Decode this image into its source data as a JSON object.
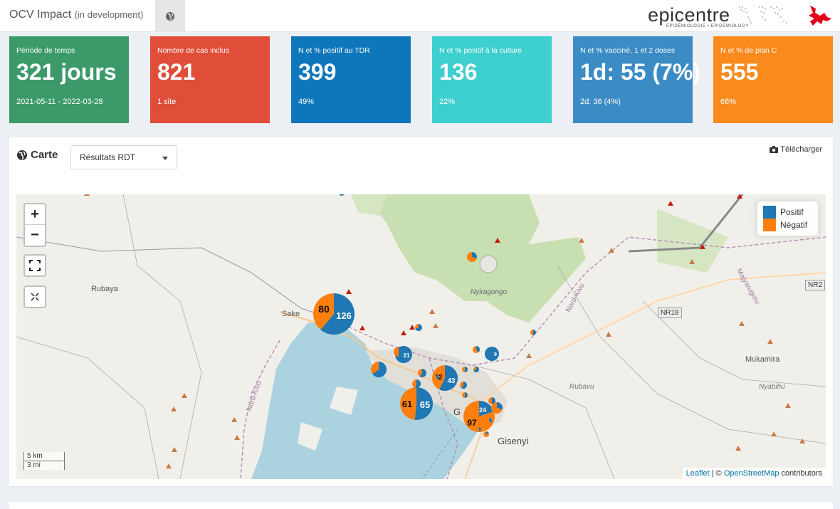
{
  "header": {
    "title": "OCV Impact",
    "subtitle": "(in development)",
    "logo_text": "epicentre",
    "logo_tagline": "ÉPIDÉMIOLOGIE • EPIDEMIOLOGY"
  },
  "value_boxes": [
    {
      "label": "Période de temps",
      "value": "321 jours",
      "sub": "2021-05-11 - 2022-03-28",
      "color": "#3c9a6a"
    },
    {
      "label": "Nombre de cas inclus",
      "value": "821",
      "sub": "1 site",
      "color": "#e04e3a"
    },
    {
      "label": "N et % positif au TDR",
      "value": "399",
      "sub": "49%",
      "color": "#0e76ba"
    },
    {
      "label": "N et % positif à la culture",
      "value": "136",
      "sub": "22%",
      "color": "#3ecfcf"
    },
    {
      "label": "N et % vacciné, 1 et 2 doses",
      "value": "1d: 55 (7%)",
      "sub": "2d: 36 (4%)",
      "color": "#3b8bc4"
    },
    {
      "label": "N et % de plan C",
      "value": "555",
      "sub": "68%",
      "color": "#fb8a1c"
    }
  ],
  "map_panel": {
    "title": "Carte",
    "dropdown_value": "Résultats RDT",
    "download_label": "Télécharger"
  },
  "map": {
    "zoom_in": "+",
    "zoom_out": "−",
    "legend": [
      {
        "label": "Positif",
        "color": "#1f77b4"
      },
      {
        "label": "Négatif",
        "color": "#ff7f0e"
      }
    ],
    "scale_km": "5 km",
    "scale_mi": "3 mi",
    "attribution_leaflet": "Leaflet",
    "attribution_sep": " | © ",
    "attribution_osm": "OpenStreetMap",
    "attribution_tail": " contributors",
    "places": [
      "Rubaya",
      "Sake",
      "Nyiragongo",
      "Nord-Kivu",
      "Mukamira",
      "Rubavu",
      "Gisenyi",
      "Nyabihu",
      "Majyaruguru",
      "Nord-Kivu",
      "G"
    ],
    "roads": [
      "NR2",
      "NR18"
    ],
    "clusters": [
      {
        "neg": 80,
        "pos": 126
      },
      {
        "neg": 61,
        "pos": 65
      },
      {
        "neg": 32,
        "pos": 43
      },
      {
        "neg": 97,
        "pos": 24
      },
      {
        "pos": 21
      },
      {
        "pos": 9
      }
    ]
  }
}
